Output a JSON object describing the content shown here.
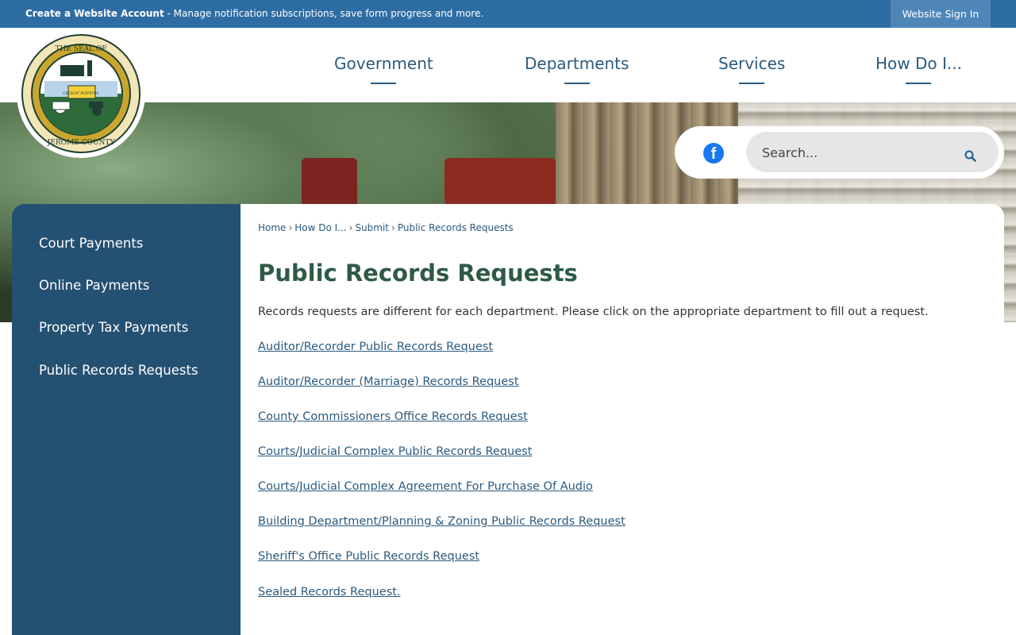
{
  "topbar": {
    "account_strong": "Create a Website Account",
    "account_rest": " - Manage notification subscriptions, save form progress and more.",
    "signin": "Website Sign In"
  },
  "logo": {
    "text_top": "THE SEAL OF",
    "text_bottom": "JEROME COUNTY",
    "motto": "CRESCAT PERPETUA"
  },
  "nav": {
    "items": [
      "Government",
      "Departments",
      "Services",
      "How Do I..."
    ]
  },
  "search": {
    "placeholder": "Search..."
  },
  "sidebar": {
    "items": [
      "Court Payments",
      "Online Payments",
      "Property Tax Payments",
      "Public Records Requests"
    ]
  },
  "breadcrumb": {
    "items": [
      "Home",
      "How Do I...",
      "Submit",
      "Public Records Requests"
    ],
    "separator": "›"
  },
  "main": {
    "title": "Public Records Requests",
    "intro": "Records requests are different for each department. Please click on the appropriate department to fill out a request.",
    "links": [
      "Auditor/Recorder Public Records Request",
      "Auditor/Recorder (Marriage) Records Request",
      "County Commissioners Office Records Request",
      "Courts/Judicial Complex Public Records Request",
      "Courts/Judicial Complex Agreement For Purchase Of Audio",
      "Building Department/Planning & Zoning Public Records Request",
      "Sheriff's Office Public Records Request",
      "Sealed Records Request."
    ]
  },
  "colors": {
    "topbar": "#2e6da4",
    "nav_text": "#2b5a7e",
    "sidebar": "#245072",
    "title": "#2e5a46",
    "facebook": "#1877f2"
  },
  "icons": {
    "social": "facebook-icon",
    "search": "search-icon"
  }
}
